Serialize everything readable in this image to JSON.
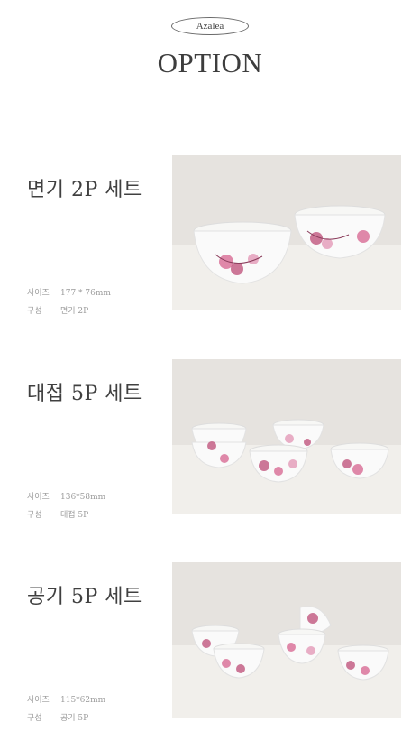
{
  "header": {
    "badge": "Azalea",
    "title": "OPTION"
  },
  "options": [
    {
      "name": "면기 2P 세트",
      "size_label": "사이즈",
      "size_value": "177 * 76mm",
      "composition_label": "구성",
      "composition_value": "면기 2P",
      "photo_icon": "two-bowl-set-photo"
    },
    {
      "name": "대접 5P 세트",
      "size_label": "사이즈",
      "size_value": "136*58mm",
      "composition_label": "구성",
      "composition_value": "대접 5P",
      "photo_icon": "five-bowl-set-photo"
    },
    {
      "name": "공기 5P 세트",
      "size_label": "사이즈",
      "size_value": "115*62mm",
      "composition_label": "구성",
      "composition_value": "공기 5P",
      "photo_icon": "five-rice-bowl-set-photo"
    }
  ],
  "colors": {
    "background": "#ffffff",
    "text": "#3a3a3a",
    "spec_text": "#9a9a9a",
    "blossom": "#c0567e"
  }
}
